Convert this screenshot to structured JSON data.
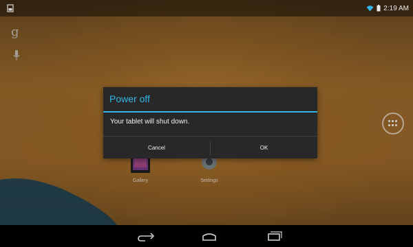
{
  "status_bar": {
    "time": "2:19 AM",
    "icons": [
      "notification-icon",
      "wifi-icon",
      "battery-icon"
    ]
  },
  "home": {
    "search_icon": "google-g-icon",
    "search_letter": "g",
    "voice_icon": "mic-icon",
    "apps": [
      {
        "name": "Gallery",
        "icon": "gallery-icon"
      },
      {
        "name": "Settings",
        "icon": "settings-icon"
      }
    ]
  },
  "dialog": {
    "title": "Power off",
    "message": "Your tablet will shut down.",
    "cancel_label": "Cancel",
    "ok_label": "OK",
    "accent_color": "#33b5e5"
  },
  "nav_bar": {
    "buttons": [
      "back-icon",
      "home-icon",
      "recent-apps-icon"
    ]
  }
}
